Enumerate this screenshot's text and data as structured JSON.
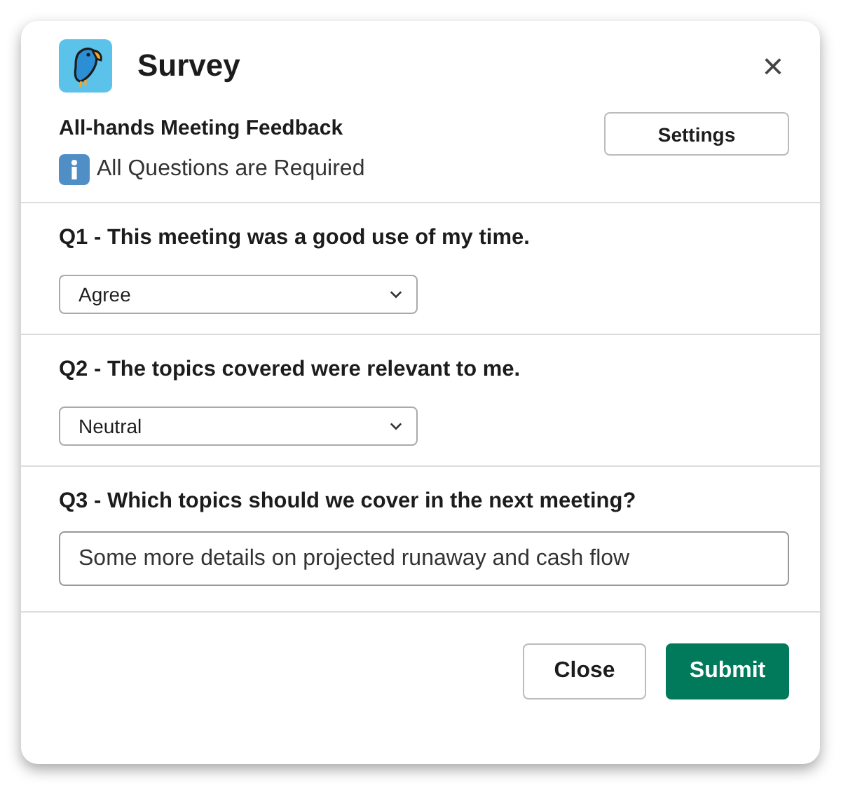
{
  "dialog": {
    "title": "Survey",
    "close_icon": "×"
  },
  "header": {
    "heading": "All-hands Meeting Feedback",
    "button": "Settings",
    "note": "All Questions are Required"
  },
  "questions": [
    {
      "kind": "select",
      "label": "Q1 - This meeting was a good use of my time.",
      "value": "Agree"
    },
    {
      "kind": "select",
      "label": "Q2 - The topics covered were relevant to me.",
      "value": "Neutral"
    },
    {
      "kind": "text",
      "label": "Q3 - Which topics should we cover in the next meeting?",
      "value": "Some more details on projected runaway and cash flow"
    }
  ],
  "buttons": [
    {
      "label": "Close",
      "kind": "secondary"
    },
    {
      "label": "Submit",
      "kind": "primary"
    }
  ]
}
